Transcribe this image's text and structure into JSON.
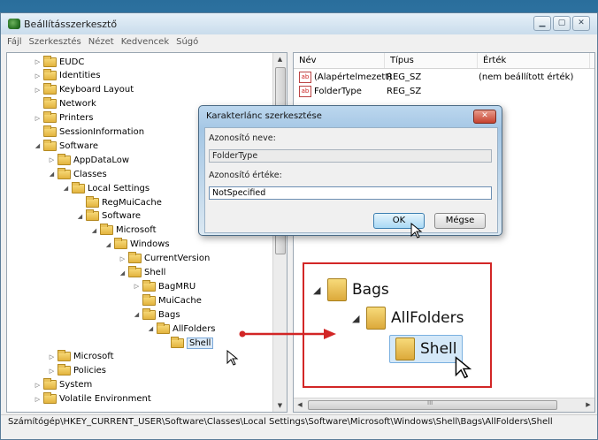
{
  "window": {
    "title": "Beállításszerkesztő"
  },
  "menu": [
    "Fájl",
    "Szerkesztés",
    "Nézet",
    "Kedvencek",
    "Súgó"
  ],
  "tree": [
    {
      "label": "EUDC",
      "depth": 0,
      "expander": "▷"
    },
    {
      "label": "Identities",
      "depth": 0,
      "expander": "▷"
    },
    {
      "label": "Keyboard Layout",
      "depth": 0,
      "expander": "▷"
    },
    {
      "label": "Network",
      "depth": 0,
      "expander": ""
    },
    {
      "label": "Printers",
      "depth": 0,
      "expander": "▷"
    },
    {
      "label": "SessionInformation",
      "depth": 0,
      "expander": ""
    },
    {
      "label": "Software",
      "depth": 0,
      "expander": "◢"
    },
    {
      "label": "AppDataLow",
      "depth": 1,
      "expander": "▷"
    },
    {
      "label": "Classes",
      "depth": 1,
      "expander": "◢"
    },
    {
      "label": "Local Settings",
      "depth": 2,
      "expander": "◢"
    },
    {
      "label": "RegMuiCache",
      "depth": 3,
      "expander": ""
    },
    {
      "label": "Software",
      "depth": 3,
      "expander": "◢"
    },
    {
      "label": "Microsoft",
      "depth": 4,
      "expander": "◢"
    },
    {
      "label": "Windows",
      "depth": 5,
      "expander": "◢"
    },
    {
      "label": "CurrentVersion",
      "depth": 6,
      "expander": "▷"
    },
    {
      "label": "Shell",
      "depth": 6,
      "expander": "◢"
    },
    {
      "label": "BagMRU",
      "depth": 7,
      "expander": "▷"
    },
    {
      "label": "MuiCache",
      "depth": 7,
      "expander": ""
    },
    {
      "label": "Bags",
      "depth": 7,
      "expander": "◢"
    },
    {
      "label": "AllFolders",
      "depth": 8,
      "expander": "◢"
    },
    {
      "label": "Shell",
      "depth": 9,
      "expander": "",
      "selected": true
    },
    {
      "label": "Microsoft",
      "depth": 1,
      "expander": "▷"
    },
    {
      "label": "Policies",
      "depth": 1,
      "expander": "▷"
    },
    {
      "label": "System",
      "depth": 0,
      "expander": "▷"
    },
    {
      "label": "Volatile Environment",
      "depth": 0,
      "expander": "▷"
    }
  ],
  "values_pane": {
    "columns": [
      "Név",
      "Típus",
      "Érték"
    ],
    "rows": [
      {
        "name": "(Alapértelmezett)",
        "type": "REG_SZ",
        "data": "(nem beállított érték)"
      },
      {
        "name": "FolderType",
        "type": "REG_SZ",
        "data": ""
      }
    ]
  },
  "dialog": {
    "title": "Karakterlánc szerkesztése",
    "name_label": "Azonosító neve:",
    "name_value": "FolderType",
    "value_label": "Azonosító értéke:",
    "value_value": "NotSpecified",
    "ok": "OK",
    "cancel": "Mégse"
  },
  "callout": {
    "bags": "Bags",
    "allfolders": "AllFolders",
    "shell": "Shell",
    "border_color": "#d22626"
  },
  "status": "Számítógép\\HKEY_CURRENT_USER\\Software\\Classes\\Local Settings\\Software\\Microsoft\\Windows\\Shell\\Bags\\AllFolders\\Shell"
}
